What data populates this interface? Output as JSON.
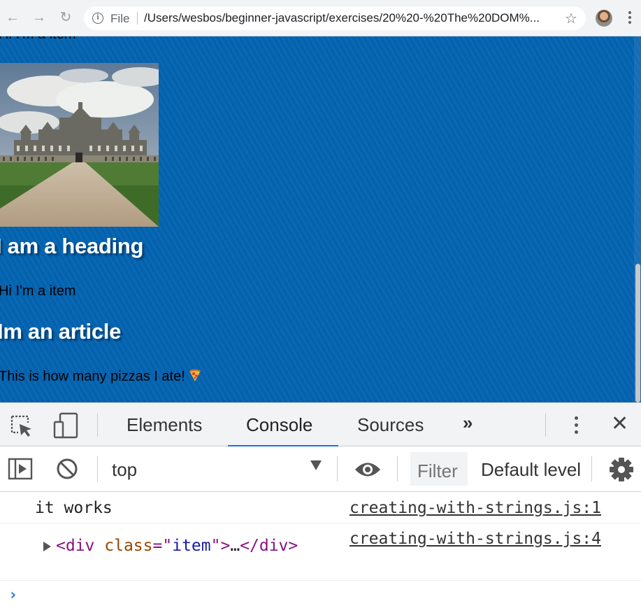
{
  "browser": {
    "scheme_label": "File",
    "url": "/Users/wesbos/beginner-javascript/exercises/20%20-%20The%20DOM%...",
    "icons": {
      "back": "arrow-left-icon",
      "forward": "arrow-right-icon",
      "reload": "reload-icon",
      "info": "info-icon",
      "star": "star-icon",
      "menu": "more-vertical-icon"
    }
  },
  "page": {
    "background": "#0464b2",
    "items": [
      {
        "type": "text",
        "text": "Hi I'm a item"
      },
      {
        "type": "image",
        "description": "castle-photo"
      },
      {
        "type": "heading",
        "text": "I am a heading"
      },
      {
        "type": "text",
        "text": "Hi I'm a item"
      },
      {
        "type": "heading",
        "text": "Im an article"
      },
      {
        "type": "text",
        "text": "This is how many pizzas I ate!",
        "emoji": "pizza-icon"
      }
    ]
  },
  "devtools": {
    "tabs": [
      {
        "label": "Elements",
        "active": false
      },
      {
        "label": "Console",
        "active": true
      },
      {
        "label": "Sources",
        "active": false
      }
    ],
    "more_tabs": "»",
    "toolbar": {
      "context": "top",
      "filter_placeholder": "Filter",
      "levels": "Default levels"
    },
    "console": {
      "logs": [
        {
          "message": "it works",
          "source": "creating-with-strings.js:1"
        },
        {
          "message": "",
          "source": "creating-with-strings.js:4",
          "element": {
            "open": "<",
            "tag": "div",
            "attr": "class",
            "eq": "=\"",
            "value": "item",
            "close": "\">",
            "ellipsis": "…",
            "end": "</div>"
          }
        }
      ],
      "prompt": "›"
    },
    "accent": "#1a73e8"
  }
}
